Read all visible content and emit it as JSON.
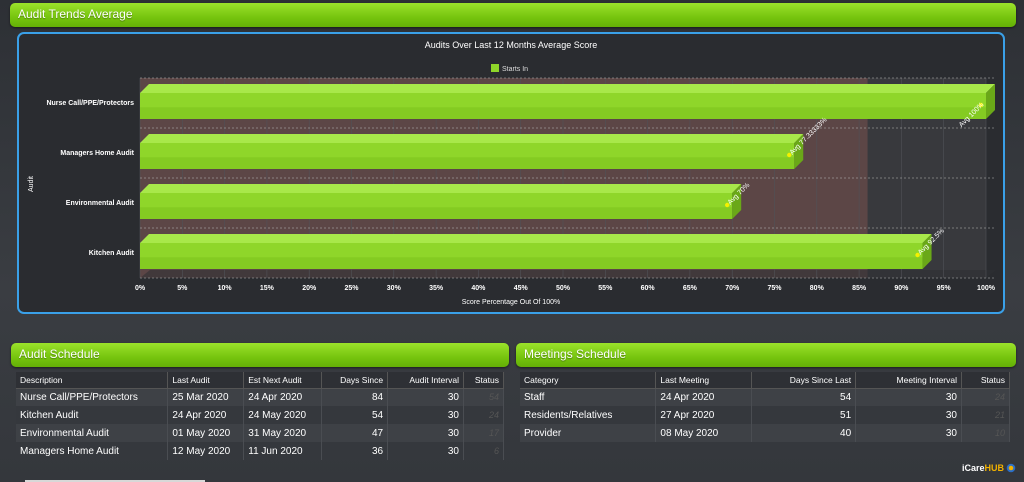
{
  "trend": {
    "title": "Audit Trends Average"
  },
  "chart_data": {
    "type": "bar",
    "orientation": "horizontal",
    "title": "Audits Over Last 12 Months Average Score",
    "xlabel": "Score Percentage Out Of 100%",
    "ylabel": "Audit",
    "legend": {
      "position": "top",
      "entries": [
        "Starts In"
      ]
    },
    "categories": [
      "Nurse Call/PPE/Protectors",
      "Managers Home Audit",
      "Environmental Audit",
      "Kitchen Audit"
    ],
    "series": [
      {
        "name": "Starts In",
        "values": [
          100,
          77.33333,
          70,
          92.5
        ]
      }
    ],
    "data_labels": [
      "Avg 100%",
      "Avg 77.33333%",
      "Avg 70%",
      "Avg 92.5%"
    ],
    "x_ticks": [
      "0%",
      "5%",
      "10%",
      "15%",
      "20%",
      "25%",
      "30%",
      "35%",
      "40%",
      "45%",
      "50%",
      "55%",
      "60%",
      "65%",
      "70%",
      "75%",
      "80%",
      "85%",
      "90%",
      "95%",
      "100%"
    ],
    "xlim": [
      0,
      100
    ],
    "highlight_band": [
      0,
      86
    ],
    "colors": {
      "bar": "#8fd62a",
      "band": "#5c4646"
    }
  },
  "audit_schedule": {
    "title": "Audit Schedule",
    "columns": [
      "Description",
      "Last Audit",
      "Est Next Audit",
      "Days Since",
      "Audit Interval",
      "Status"
    ],
    "rows": [
      [
        "Nurse Call/PPE/Protectors",
        "25 Mar 2020",
        "24 Apr 2020",
        "84",
        "30",
        "54"
      ],
      [
        "Kitchen Audit",
        "24 Apr 2020",
        "24 May 2020",
        "54",
        "30",
        "24"
      ],
      [
        "Environmental Audit",
        "01 May 2020",
        "31 May 2020",
        "47",
        "30",
        "17"
      ],
      [
        "Managers Home Audit",
        "12 May 2020",
        "11 Jun 2020",
        "36",
        "30",
        "6"
      ]
    ]
  },
  "meetings_schedule": {
    "title": "Meetings Schedule",
    "columns": [
      "Category",
      "Last Meeting",
      "Days Since Last",
      "Meeting Interval",
      "Status"
    ],
    "rows": [
      [
        "Staff",
        "24 Apr 2020",
        "54",
        "30",
        "24"
      ],
      [
        "Residents/Relatives",
        "27 Apr 2020",
        "51",
        "30",
        "21"
      ],
      [
        "Provider",
        "08 May 2020",
        "40",
        "30",
        "10"
      ]
    ]
  },
  "logo": {
    "part1": "iCare",
    "part2": "HUB"
  }
}
